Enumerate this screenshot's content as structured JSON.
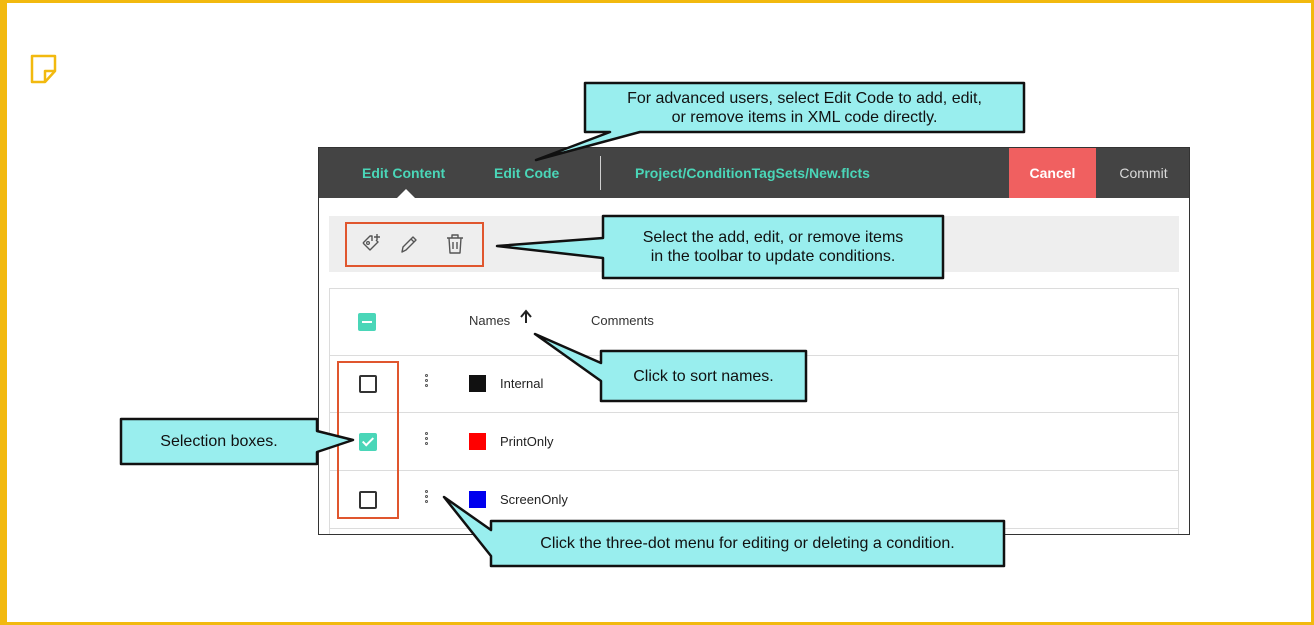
{
  "header": {
    "tab_edit_content": "Edit Content",
    "tab_edit_code": "Edit Code",
    "file_path": "Project/ConditionTagSets/New.flcts",
    "cancel_label": "Cancel",
    "commit_label": "Commit"
  },
  "toolbar": {
    "add_icon": "add-tag-icon",
    "edit_icon": "pencil-icon",
    "remove_icon": "trash-icon"
  },
  "table": {
    "column_names": "Names",
    "column_comments": "Comments",
    "sort_direction": "ascending",
    "rows": [
      {
        "name": "Internal",
        "color": "#111111",
        "checked": false
      },
      {
        "name": "PrintOnly",
        "color": "#ff0000",
        "checked": true
      },
      {
        "name": "ScreenOnly",
        "color": "#0000ee",
        "checked": false
      }
    ]
  },
  "callouts": {
    "edit_code_line1": "For advanced users, select Edit Code to add, edit,",
    "edit_code_line2": "or remove items in XML code directly.",
    "toolbar_line1": "Select  the add, edit, or remove items",
    "toolbar_line2": "in the toolbar to update conditions.",
    "sort": "Click to sort names.",
    "selection": "Selection boxes.",
    "three_dot": "Click the three-dot menu for editing or deleting a condition."
  },
  "colors": {
    "accent": "#4ad6b8",
    "cancel": "#f06060",
    "callout_fill": "#99eeee",
    "highlight": "#e0562e",
    "note_border": "#f2b90f"
  }
}
